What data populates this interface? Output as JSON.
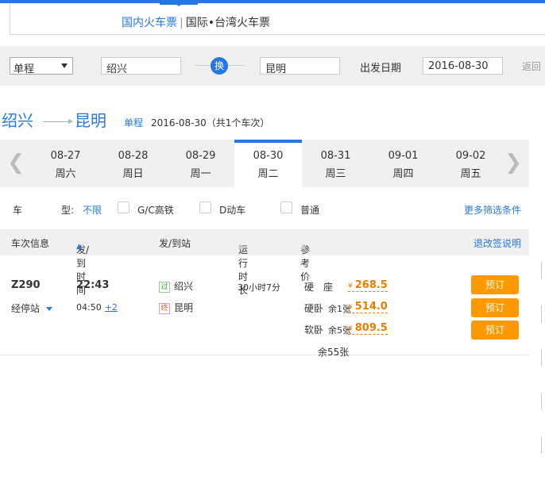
{
  "nav": {
    "domestic": "国内火车票",
    "separator": "|",
    "intl": "国际•台湾火车票"
  },
  "search": {
    "trip_type": "单程",
    "from": "绍兴",
    "swap": "换",
    "to": "昆明",
    "date_label": "出发日期",
    "date": "2016-08-30",
    "return_label": "返回"
  },
  "route": {
    "from": "绍兴",
    "to": "昆明",
    "type": "单程",
    "summary": "2016-08-30（共1个车次）"
  },
  "dates": [
    {
      "date": "08-27",
      "weekday": "周六",
      "active": false
    },
    {
      "date": "08-28",
      "weekday": "周日",
      "active": false
    },
    {
      "date": "08-29",
      "weekday": "周一",
      "active": false
    },
    {
      "date": "08-30",
      "weekday": "周二",
      "active": true
    },
    {
      "date": "08-31",
      "weekday": "周三",
      "active": false
    },
    {
      "date": "09-01",
      "weekday": "周四",
      "active": false
    },
    {
      "date": "09-02",
      "weekday": "周五",
      "active": false
    }
  ],
  "filter": {
    "label_a": "车",
    "label_b": "型:",
    "any": "不限",
    "opt1": "G/C高铁",
    "opt2": "D动车",
    "opt3": "普通",
    "more": "更多筛选条件"
  },
  "table_header": {
    "train": "车次信息",
    "time": "发/到时间",
    "station": "发/到站",
    "duration": "运行时长",
    "price": "参考价",
    "rule": "退改签说明"
  },
  "train": {
    "number": "Z290",
    "stops": "经停站",
    "depart": "22:43",
    "arrive": "04:50",
    "plus_days": "+2",
    "from_tag": "过",
    "from_station": "绍兴",
    "to_tag": "终",
    "to_station": "昆明",
    "duration": "30小时7分",
    "seats": [
      {
        "name": "硬　座",
        "price": "268.5",
        "yen": "¥",
        "avail": "",
        "book": "预订"
      },
      {
        "name": "硬卧",
        "price": "514.0",
        "yen": "¥",
        "avail": "余1张",
        "book": "预订"
      },
      {
        "name": "软卧",
        "price": "809.5",
        "yen": "¥",
        "avail": "余5张",
        "book": "预订"
      }
    ],
    "remaining": "余55张"
  },
  "icons": {
    "prev": "chevron-left-icon",
    "next": "chevron-right-icon"
  },
  "colors": {
    "accent": "#2577e3",
    "book": "#ff9900",
    "price": "#e67e00"
  }
}
